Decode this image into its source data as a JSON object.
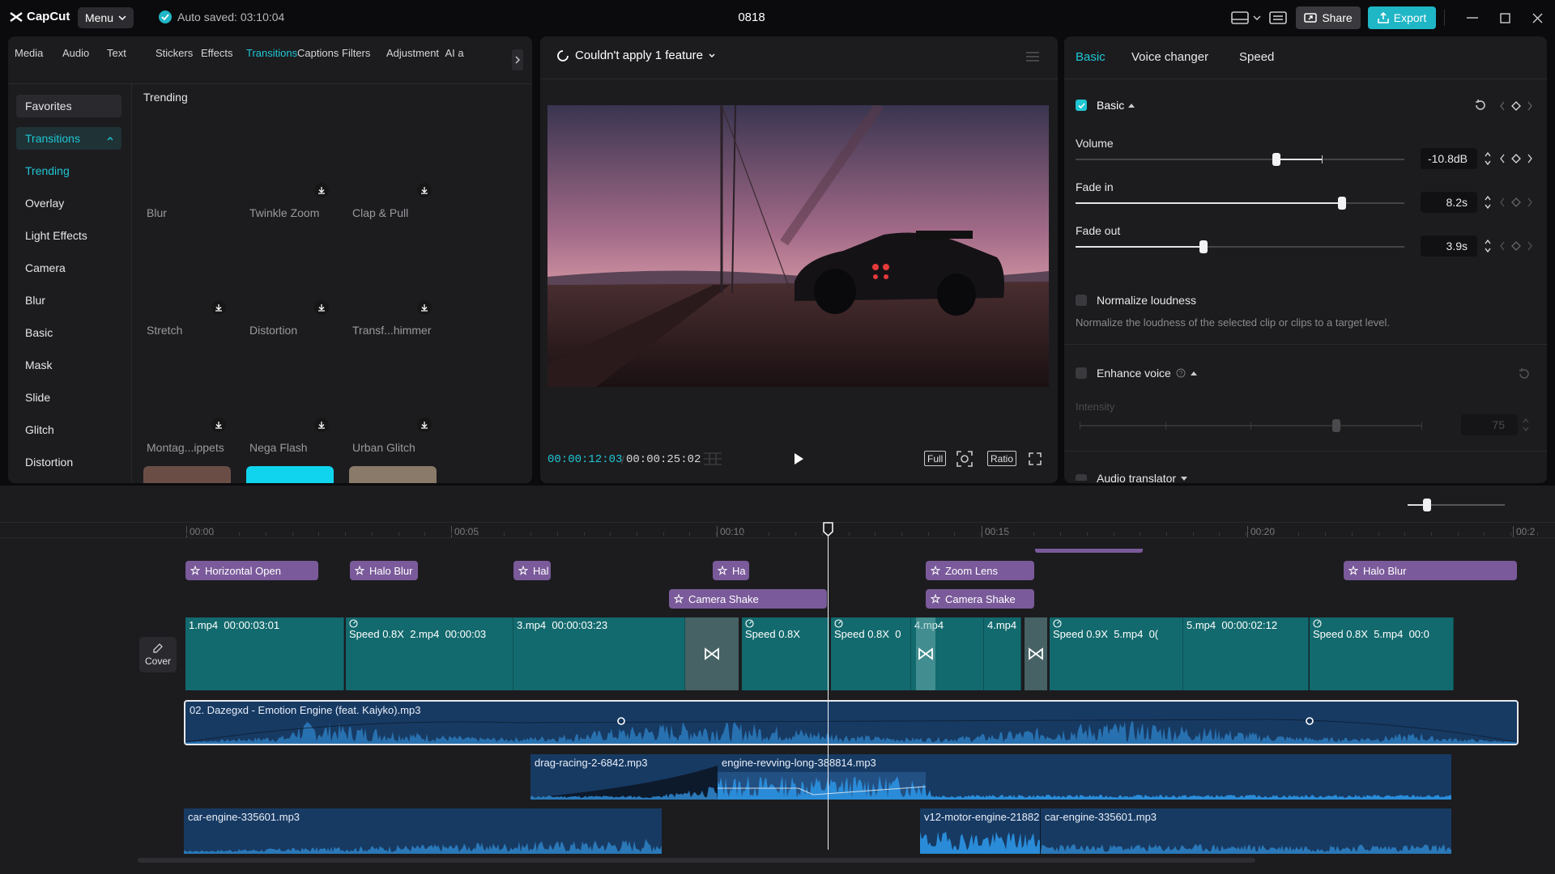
{
  "app": {
    "name": "CapCut",
    "menu_label": "Menu",
    "autosave": "Auto saved: 03:10:04",
    "project_title": "0818",
    "share_label": "Share",
    "export_label": "Export"
  },
  "colors": {
    "accent": "#1fc7d4",
    "fx_clip": "#7a5a9a",
    "video_clip": "#136a6e",
    "audio_clip": "#173a63"
  },
  "tool_tabs": [
    {
      "label": "Media",
      "icon": "media-icon"
    },
    {
      "label": "Audio",
      "icon": "audio-icon"
    },
    {
      "label": "Text",
      "icon": "text-icon"
    },
    {
      "label": "Stickers",
      "icon": "stickers-icon"
    },
    {
      "label": "Effects",
      "icon": "effects-icon"
    },
    {
      "label": "Transitions",
      "icon": "transitions-icon",
      "active": true
    },
    {
      "label": "Captions",
      "icon": "captions-icon"
    },
    {
      "label": "Filters",
      "icon": "filters-icon"
    },
    {
      "label": "Adjustment",
      "icon": "adjustment-icon"
    },
    {
      "label": "AI a",
      "icon": "ai-icon"
    }
  ],
  "left_nav": {
    "favorites": "Favorites",
    "section": "Transitions",
    "items": [
      "Trending",
      "Overlay",
      "Light Effects",
      "Camera",
      "Blur",
      "Basic",
      "Mask",
      "Slide",
      "Glitch",
      "Distortion"
    ]
  },
  "library": {
    "heading": "Trending",
    "items": [
      "Blur",
      "Twinkle Zoom",
      "Clap & Pull",
      "Stretch",
      "Distortion",
      "Transf...himmer",
      "Montag...ippets",
      "Nega Flash",
      "Urban Glitch"
    ]
  },
  "player": {
    "status": "Couldn't apply 1 feature",
    "current_time": "00:00:12:03",
    "total_time": "00:00:25:02",
    "full_label": "Full",
    "ratio_label": "Ratio"
  },
  "right_panel": {
    "tabs": [
      "Basic",
      "Voice changer",
      "Speed"
    ],
    "basic_section": "Basic",
    "volume": {
      "label": "Volume",
      "value": "-10.8dB",
      "level": 0.61
    },
    "fade_in": {
      "label": "Fade in",
      "value": "8.2s",
      "level": 0.81
    },
    "fade_out": {
      "label": "Fade out",
      "value": "3.9s",
      "level": 0.39
    },
    "normalize": {
      "label": "Normalize loudness",
      "desc": "Normalize the loudness of the selected clip or clips to a target level."
    },
    "enhance": {
      "label": "Enhance voice",
      "intensity_label": "Intensity",
      "intensity_value": "75",
      "level": 0.75
    },
    "audio_translator": "Audio translator"
  },
  "timeline": {
    "ruler": [
      "00:00",
      "00:05",
      "00:10",
      "00:15",
      "00:20",
      "00:2"
    ],
    "cover_label": "Cover",
    "effects_row1": [
      "Horizontal Open",
      "Halo Blur",
      "Hal",
      "Ha",
      "Zoom Lens",
      "Halo Blur"
    ],
    "effects_row2": [
      "Camera Shake",
      "Camera Shake"
    ],
    "video_clips": [
      {
        "name": "1.mp4",
        "dur": "00:00:03:01"
      },
      {
        "speed": "Speed 0.8X",
        "name": "2.mp4",
        "dur": "00:00:03"
      },
      {
        "name": "3.mp4",
        "dur": "00:00:03:23"
      },
      {
        "speed": "Speed 0.8X"
      },
      {
        "speed": "Speed 0.8X",
        "name": "0"
      },
      {
        "name": "4.mp4"
      },
      {
        "name": "4.mp4",
        "dur": "0("
      },
      {
        "speed": "Speed 0.9X",
        "name": "5.mp4",
        "dur": "0("
      },
      {
        "name": "5.mp4",
        "dur": "00:00:02:12"
      },
      {
        "speed": "Speed 0.8X",
        "name": "5.mp4",
        "dur": "00:0"
      }
    ],
    "audio_main": "02. Dazegxd - Emotion Engine (feat. Kaiyko).mp3",
    "audio_sfx1": [
      "drag-racing-2-6842.mp3",
      "engine-revving-long-388814.mp3"
    ],
    "audio_sfx2": [
      "car-engine-335601.mp3",
      "v12-motor-engine-21882",
      "car-engine-335601.mp3"
    ],
    "playhead_time": "00:00:12:03"
  }
}
